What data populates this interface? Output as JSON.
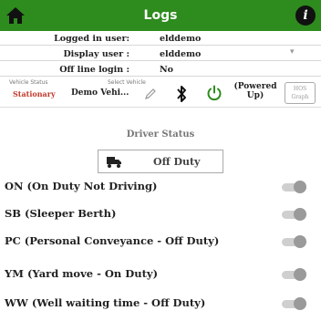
{
  "header": {
    "title": "Logs",
    "home_icon": "home-icon",
    "info_icon": "info-icon",
    "info_glyph": "i",
    "accent": "#2e8b1e"
  },
  "info": {
    "logged_in_label": "Logged in user:",
    "logged_in_value": "elddemo",
    "display_label": "Display user :",
    "display_value": "elddemo",
    "offline_label": "Off line login :",
    "offline_value": "No"
  },
  "vehicle": {
    "status_label": "Vehicle Status",
    "status_value": "Stationary",
    "status_color": "#c0392b",
    "select_label": "Select Vehicle",
    "select_value": "Demo Vehi...",
    "powered_line1": "(Powered",
    "powered_line2": "Up)",
    "hos_line1": "HOS",
    "hos_line2": "Graph"
  },
  "driver": {
    "title": "Driver Status",
    "current": "Off Duty"
  },
  "options": [
    {
      "label": "ON (On Duty Not Driving)",
      "on": false
    },
    {
      "label": "SB (Sleeper Berth)",
      "on": false
    },
    {
      "label": "PC (Personal Conveyance - Off Duty)",
      "on": false
    },
    {
      "label": "YM (Yard move - On Duty)",
      "on": false
    },
    {
      "label": "WW (Well waiting time - Off Duty)",
      "on": false
    }
  ]
}
